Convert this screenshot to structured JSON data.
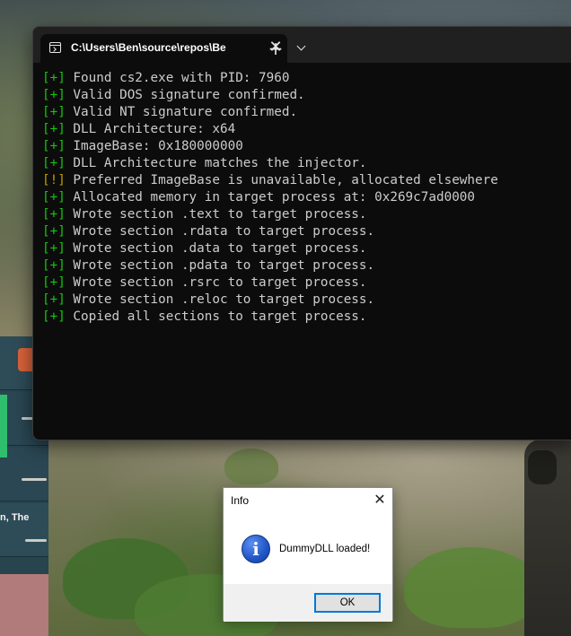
{
  "terminal": {
    "tab_title": "C:\\Users\\Ben\\source\\repos\\Be",
    "tab_close": "✕",
    "new_tab": "+",
    "lines": [
      {
        "tag": "[+]",
        "text": " Found cs2.exe with PID: 7960"
      },
      {
        "tag": "[+]",
        "text": " Valid DOS signature confirmed."
      },
      {
        "tag": "[+]",
        "text": " Valid NT signature confirmed."
      },
      {
        "tag": "[+]",
        "text": " DLL Architecture: x64"
      },
      {
        "tag": "[+]",
        "text": " ImageBase: 0x180000000"
      },
      {
        "tag": "[+]",
        "text": " DLL Architecture matches the injector."
      },
      {
        "tag": "[!]",
        "text": " Preferred ImageBase is unavailable, allocated elsewhere"
      },
      {
        "tag": "[+]",
        "text": " Allocated memory in target process at: 0x269c7ad0000"
      },
      {
        "tag": "[+]",
        "text": " Wrote section .text to target process."
      },
      {
        "tag": "[+]",
        "text": " Wrote section .rdata to target process."
      },
      {
        "tag": "[+]",
        "text": " Wrote section .data to target process."
      },
      {
        "tag": "[+]",
        "text": " Wrote section .pdata to target process."
      },
      {
        "tag": "[+]",
        "text": " Wrote section .rsrc to target process."
      },
      {
        "tag": "[+]",
        "text": " Wrote section .reloc to target process."
      },
      {
        "tag": "[+]",
        "text": " Copied all sections to target process."
      }
    ]
  },
  "dialog": {
    "title": "Info",
    "close": "✕",
    "icon_glyph": "i",
    "message": "DummyDLL loaded!",
    "ok_label": "OK"
  },
  "background": {
    "inventory_label": "n, The"
  },
  "colors": {
    "ok_tag": "#16c60c",
    "warn_tag": "#c19c00",
    "terminal_bg": "#0c0c0c",
    "terminal_text": "#cccccc"
  }
}
